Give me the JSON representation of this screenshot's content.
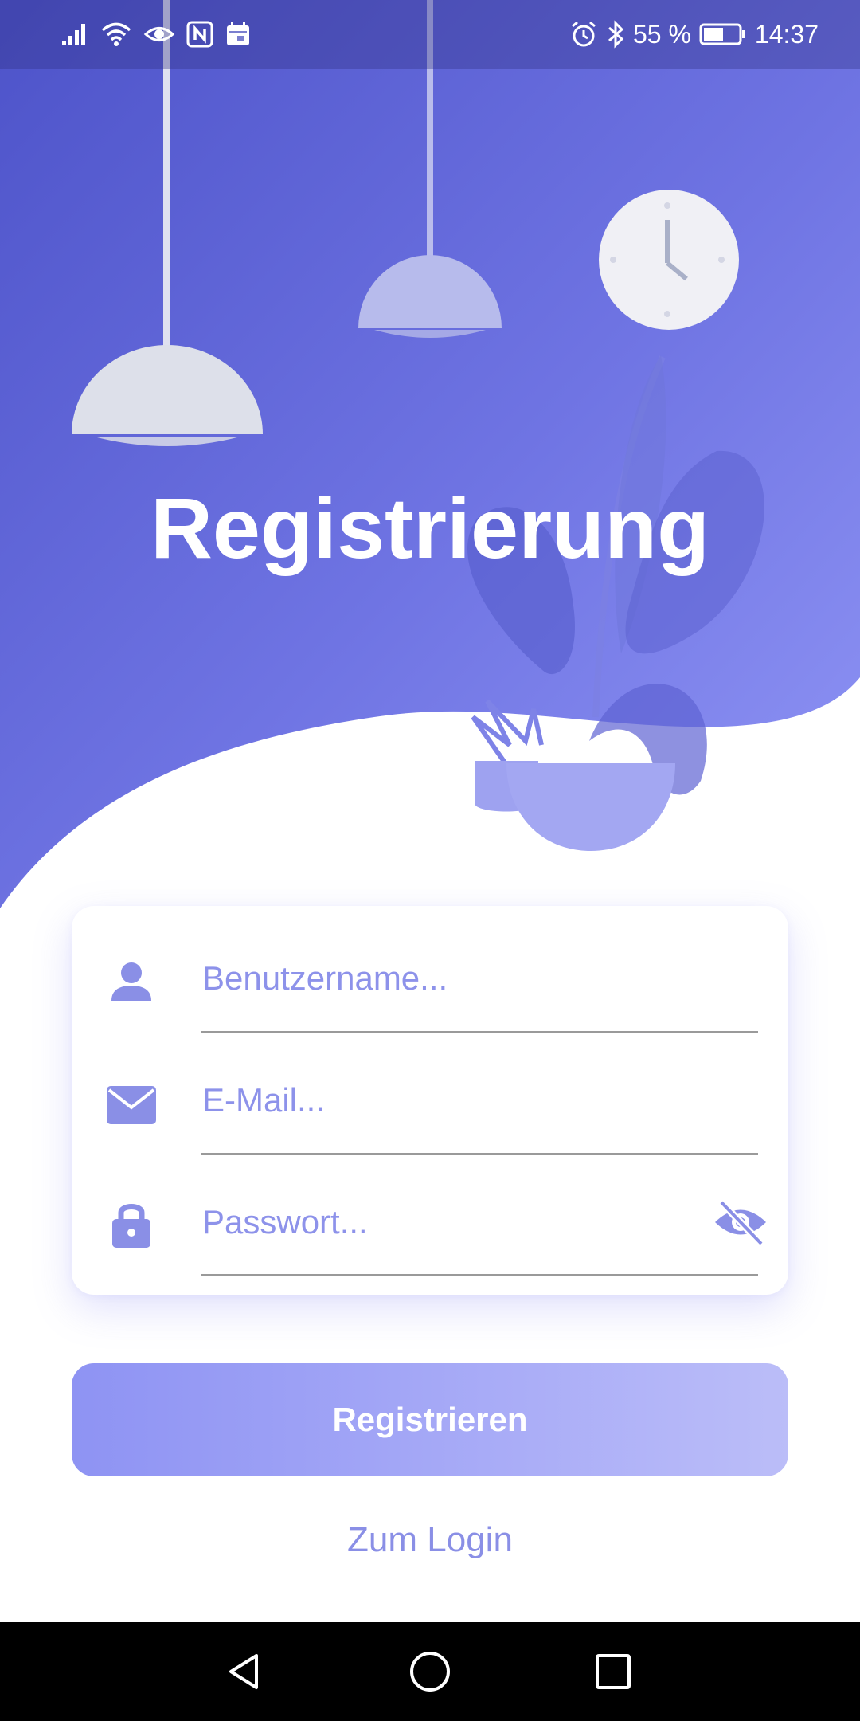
{
  "status_bar": {
    "battery_percent": "55 %",
    "time": "14:37",
    "icons_left": [
      "signal-icon",
      "wifi-icon",
      "eye-icon",
      "nfc-icon",
      "calendar-icon"
    ],
    "icons_right": [
      "alarm-icon",
      "bluetooth-icon",
      "battery-icon"
    ]
  },
  "header": {
    "title": "Registrierung"
  },
  "form": {
    "username_placeholder": "Benutzername...",
    "email_placeholder": "E-Mail...",
    "password_placeholder": "Passwort..."
  },
  "actions": {
    "register_label": "Registrieren",
    "login_link_label": "Zum Login"
  },
  "colors": {
    "accent": "#8a8fe6",
    "hero_gradient_start": "#4f55cc",
    "hero_gradient_end": "#8b90f2",
    "button_gradient_start": "#8e93f3",
    "button_gradient_end": "#bbbdf8"
  },
  "nav_bar": {
    "icons": [
      "back-icon",
      "home-icon",
      "recents-icon"
    ]
  }
}
